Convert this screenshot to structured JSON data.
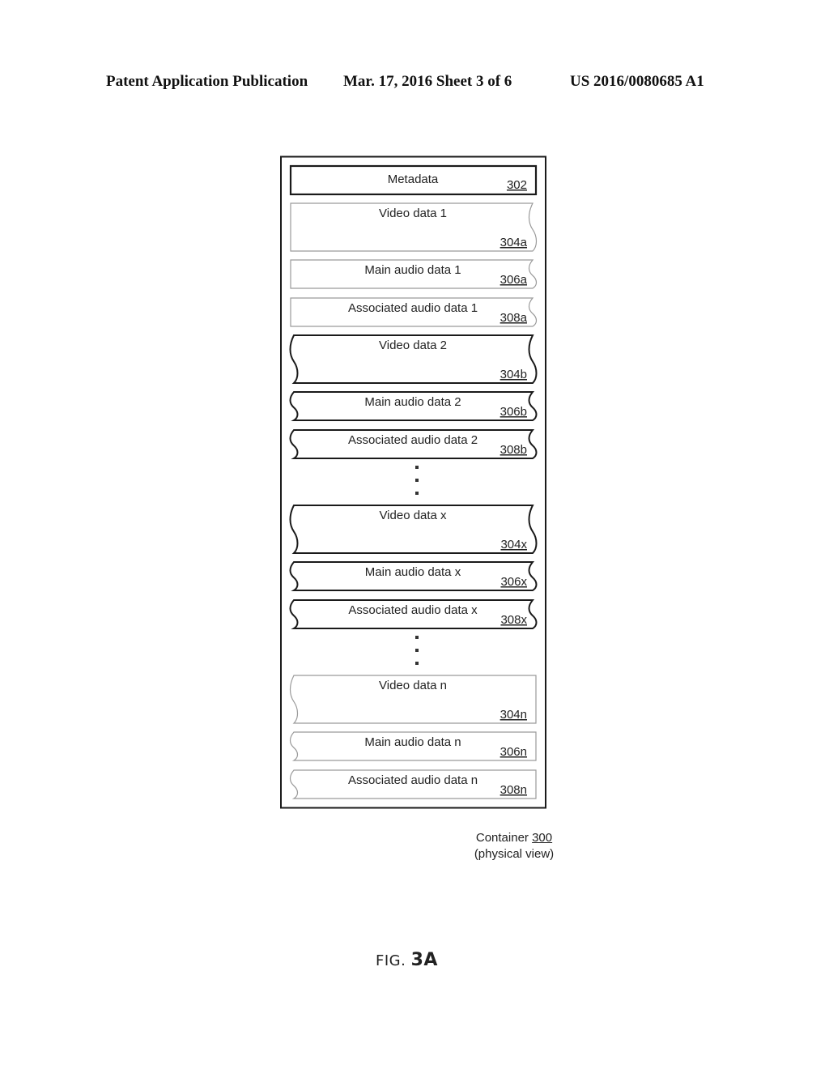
{
  "header": {
    "publication": "Patent Application Publication",
    "date_sheet": "Mar. 17, 2016  Sheet 3 of 6",
    "number": "US 2016/0080685 A1"
  },
  "diagram": {
    "metadata": {
      "label": "Metadata",
      "ref": "302"
    },
    "groups": [
      {
        "id": "1",
        "style": "right-wavy-light",
        "items": [
          {
            "label": "Video data 1",
            "ref": "304a",
            "kind": "video"
          },
          {
            "label": "Main audio data 1",
            "ref": "306a",
            "kind": "audio"
          },
          {
            "label": "Associated audio data 1",
            "ref": "308a",
            "kind": "audio"
          }
        ]
      },
      {
        "id": "2",
        "style": "both-wavy-dark",
        "items": [
          {
            "label": "Video data 2",
            "ref": "304b",
            "kind": "video"
          },
          {
            "label": "Main audio data 2",
            "ref": "306b",
            "kind": "audio"
          },
          {
            "label": "Associated audio data 2",
            "ref": "308b",
            "kind": "audio"
          }
        ]
      },
      {
        "id": "x",
        "style": "both-wavy-dark",
        "items": [
          {
            "label": "Video data x",
            "ref": "304x",
            "kind": "video"
          },
          {
            "label": "Main audio data x",
            "ref": "306x",
            "kind": "audio"
          },
          {
            "label": "Associated audio data x",
            "ref": "308x",
            "kind": "audio"
          }
        ]
      },
      {
        "id": "n",
        "style": "left-wavy-light",
        "items": [
          {
            "label": "Video data n",
            "ref": "304n",
            "kind": "video"
          },
          {
            "label": "Main audio data n",
            "ref": "306n",
            "kind": "audio"
          },
          {
            "label": "Associated audio data n",
            "ref": "308n",
            "kind": "audio"
          }
        ]
      }
    ],
    "ellipsis_after_groups": [
      "2",
      "x"
    ]
  },
  "caption": {
    "title": "Container",
    "ref": "300",
    "subtitle": "(physical view)"
  },
  "figure": {
    "prefix": "FIG.",
    "number": "3A"
  },
  "colors": {
    "dark_stroke": "#1a1a1a",
    "light_stroke": "#9a9a9a",
    "text": "#222222"
  }
}
